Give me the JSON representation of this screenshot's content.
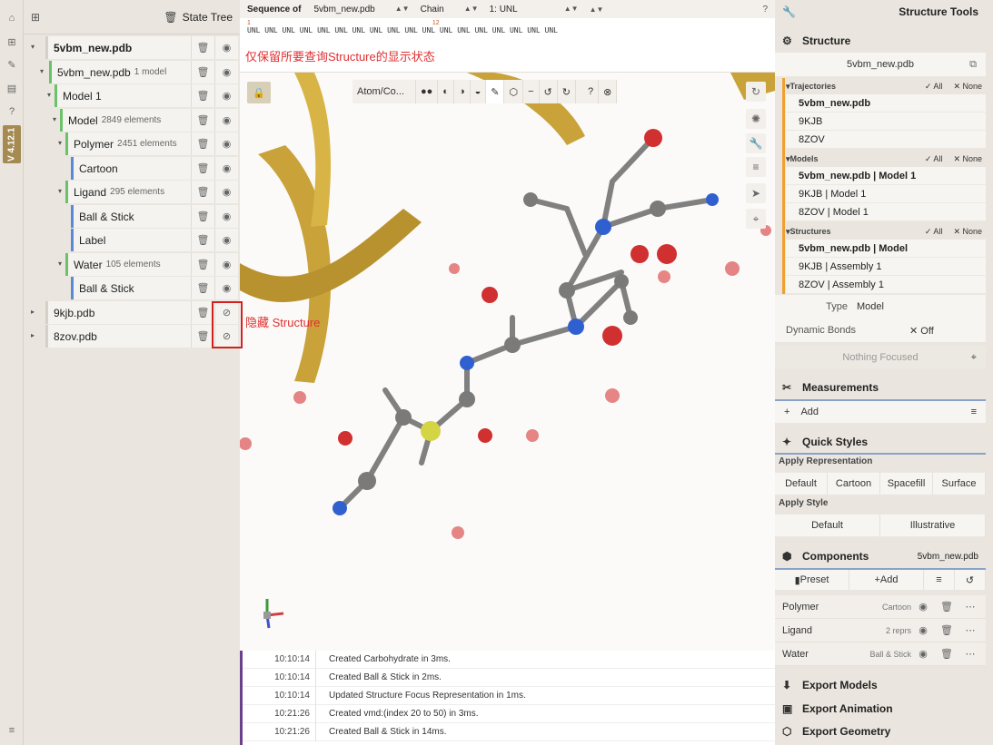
{
  "rail": {
    "version": "V 4.12.1"
  },
  "state_tree": {
    "title": "State Tree",
    "rows": [
      {
        "label": "5vbm_new.pdb",
        "sub": "",
        "bold": true
      },
      {
        "label": "5vbm_new.pdb",
        "sub": "1 model"
      },
      {
        "label": "Model 1",
        "sub": ""
      },
      {
        "label": "Model",
        "sub": "2849 elements"
      },
      {
        "label": "Polymer",
        "sub": "2451 elements"
      },
      {
        "label": "Cartoon",
        "sub": ""
      },
      {
        "label": "Ligand",
        "sub": "295 elements"
      },
      {
        "label": "Ball & Stick",
        "sub": ""
      },
      {
        "label": "Label",
        "sub": ""
      },
      {
        "label": "Water",
        "sub": "105 elements"
      },
      {
        "label": "Ball & Stick",
        "sub": ""
      },
      {
        "label": "9kjb.pdb",
        "sub": ""
      },
      {
        "label": "8zov.pdb",
        "sub": ""
      }
    ]
  },
  "sequence": {
    "label": "Sequence of",
    "structure": "5vbm_new.pdb",
    "mode": "Chain",
    "chain": "1: UNL",
    "num1": "1",
    "num2": "12",
    "residues": "UNL UNL UNL UNL UNL UNL UNL UNL UNL UNL UNL UNL UNL UNL UNL UNL UNL UNL"
  },
  "annotations": {
    "top": "仅保留所要查询Structure的显示状态",
    "hide": "隐藏 Structure"
  },
  "viewport_toolbar": {
    "mode": "Atom/Co..."
  },
  "log": [
    {
      "time": "10:10:14",
      "msg": "Created Carbohydrate in 3ms."
    },
    {
      "time": "10:10:14",
      "msg": "Created Ball & Stick in 2ms."
    },
    {
      "time": "10:10:14",
      "msg": "Updated Structure Focus Representation in 1ms."
    },
    {
      "time": "10:21:26",
      "msg": "Created vmd:(index 20 to 50) in 3ms."
    },
    {
      "time": "10:21:26",
      "msg": "Created Ball & Stick in 14ms."
    }
  ],
  "right": {
    "tools_title": "Structure Tools",
    "structure_title": "Structure",
    "structure_name": "5vbm_new.pdb",
    "trajectories": {
      "title": "Trajectories",
      "all": "All",
      "none": "None",
      "items": [
        "5vbm_new.pdb",
        "9KJB",
        "8ZOV"
      ]
    },
    "models": {
      "title": "Models",
      "all": "All",
      "none": "None",
      "items": [
        "5vbm_new.pdb | Model 1",
        "9KJB | Model 1",
        "8ZOV | Model 1"
      ]
    },
    "structures": {
      "title": "Structures",
      "all": "All",
      "none": "None",
      "items": [
        "5vbm_new.pdb | Model",
        "9KJB | Assembly 1",
        "8ZOV | Assembly 1"
      ]
    },
    "type_label": "Type",
    "type_value": "Model",
    "dyn_label": "Dynamic Bonds",
    "dyn_value": "Off",
    "nothing_focused": "Nothing Focused",
    "measurements": "Measurements",
    "add": "Add",
    "quick_styles": "Quick Styles",
    "apply_rep": "Apply Representation",
    "reps": [
      "Default",
      "Cartoon",
      "Spacefill",
      "Surface"
    ],
    "apply_style": "Apply Style",
    "styles": [
      "Default",
      "Illustrative"
    ],
    "components": "Components",
    "components_struct": "5vbm_new.pdb",
    "preset": "Preset",
    "comp_add": "Add",
    "comp_items": [
      {
        "name": "Polymer",
        "repr": "Cartoon"
      },
      {
        "name": "Ligand",
        "repr": "2 reprs"
      },
      {
        "name": "Water",
        "repr": "Ball & Stick"
      }
    ],
    "export_models": "Export Models",
    "export_animation": "Export Animation",
    "export_geometry": "Export Geometry"
  }
}
